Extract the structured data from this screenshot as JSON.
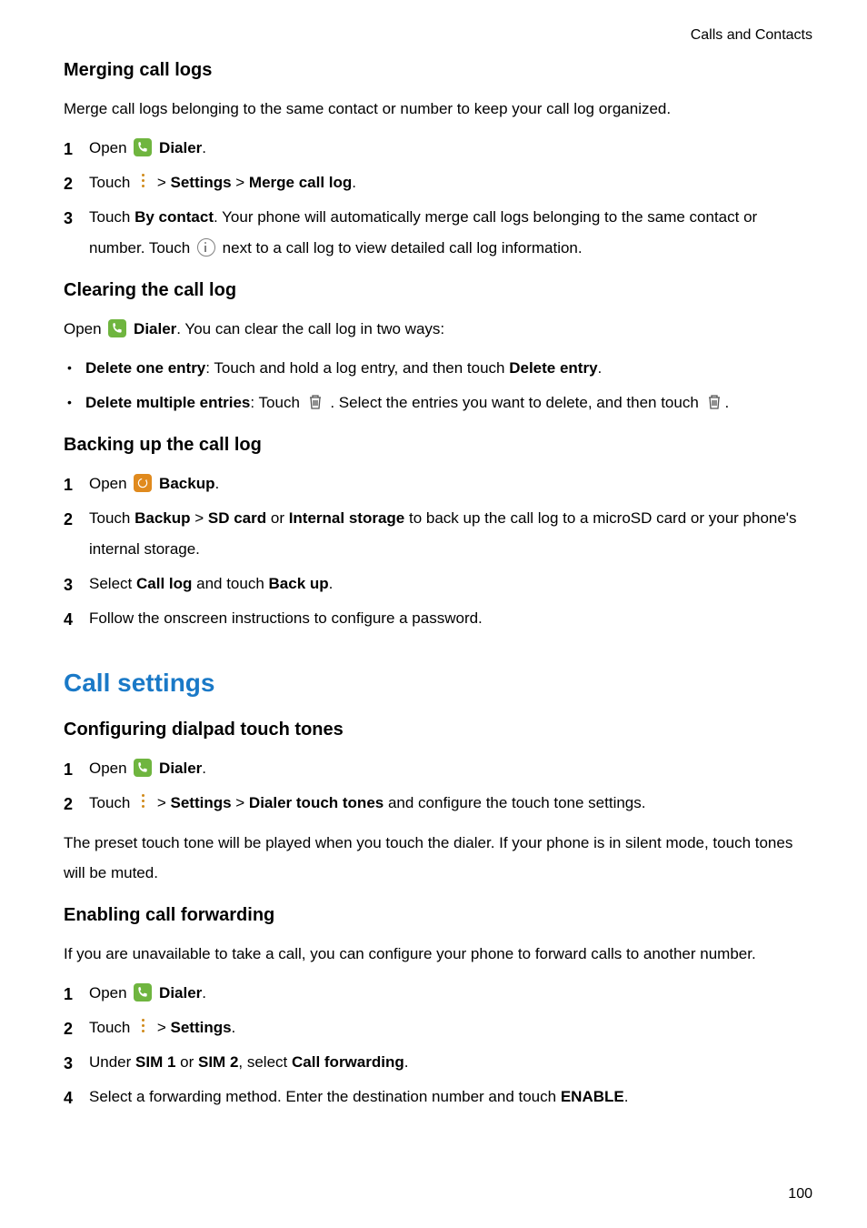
{
  "header": {
    "breadcrumb": "Calls and Contacts"
  },
  "sec_merge": {
    "title": "Merging call logs",
    "intro": "Merge call logs belonging to the same contact or number to keep your call log organized.",
    "step1_a": "Open ",
    "step1_b": "Dialer",
    "step1_c": ".",
    "step2_a": "Touch ",
    "step2_b": " > ",
    "step2_c": "Settings",
    "step2_d": " > ",
    "step2_e": "Merge call log",
    "step2_f": ".",
    "step3_a": "Touch ",
    "step3_b": "By contact",
    "step3_c": ". Your phone will automatically merge call logs belonging to the same contact or number. Touch ",
    "step3_d": " next to a call log to view detailed call log information."
  },
  "sec_clear": {
    "title": "Clearing the call log",
    "intro_a": "Open ",
    "intro_b": "Dialer",
    "intro_c": ". You can clear the call log in two ways:",
    "b1_a": "Delete one entry",
    "b1_b": ": Touch and hold a log entry, and then touch ",
    "b1_c": "Delete entry",
    "b1_d": ".",
    "b2_a": "Delete multiple entries",
    "b2_b": ": Touch ",
    "b2_c": ". Select the entries you want to delete, and then touch ",
    "b2_d": "."
  },
  "sec_backup": {
    "title": "Backing up the call log",
    "step1_a": "Open ",
    "step1_b": "Backup",
    "step1_c": ".",
    "step2_a": "Touch ",
    "step2_b": "Backup",
    "step2_c": " > ",
    "step2_d": "SD card",
    "step2_e": " or ",
    "step2_f": "Internal storage",
    "step2_g": " to back up the call log to a microSD card or your phone's internal storage.",
    "step3_a": "Select ",
    "step3_b": "Call log",
    "step3_c": " and touch ",
    "step3_d": "Back up",
    "step3_e": ".",
    "step4": "Follow the onscreen instructions to configure a password."
  },
  "h2": "Call settings",
  "sec_tones": {
    "title": "Configuring dialpad touch tones",
    "step1_a": "Open ",
    "step1_b": "Dialer",
    "step1_c": ".",
    "step2_a": "Touch ",
    "step2_b": " > ",
    "step2_c": "Settings",
    "step2_d": " > ",
    "step2_e": "Dialer touch tones",
    "step2_f": " and configure the touch tone settings.",
    "outro": "The preset touch tone will be played when you touch the dialer. If your phone is in silent mode, touch tones will be muted."
  },
  "sec_fwd": {
    "title": "Enabling call forwarding",
    "intro": "If you are unavailable to take a call, you can configure your phone to forward calls to another number.",
    "step1_a": "Open ",
    "step1_b": "Dialer",
    "step1_c": ".",
    "step2_a": "Touch ",
    "step2_b": " > ",
    "step2_c": "Settings",
    "step2_d": ".",
    "step3_a": "Under ",
    "step3_b": "SIM 1",
    "step3_c": " or ",
    "step3_d": "SIM 2",
    "step3_e": ", select ",
    "step3_f": "Call forwarding",
    "step3_g": ".",
    "step4_a": "Select a forwarding method. Enter the destination number and touch ",
    "step4_b": "ENABLE",
    "step4_c": "."
  },
  "pagenum": "100"
}
